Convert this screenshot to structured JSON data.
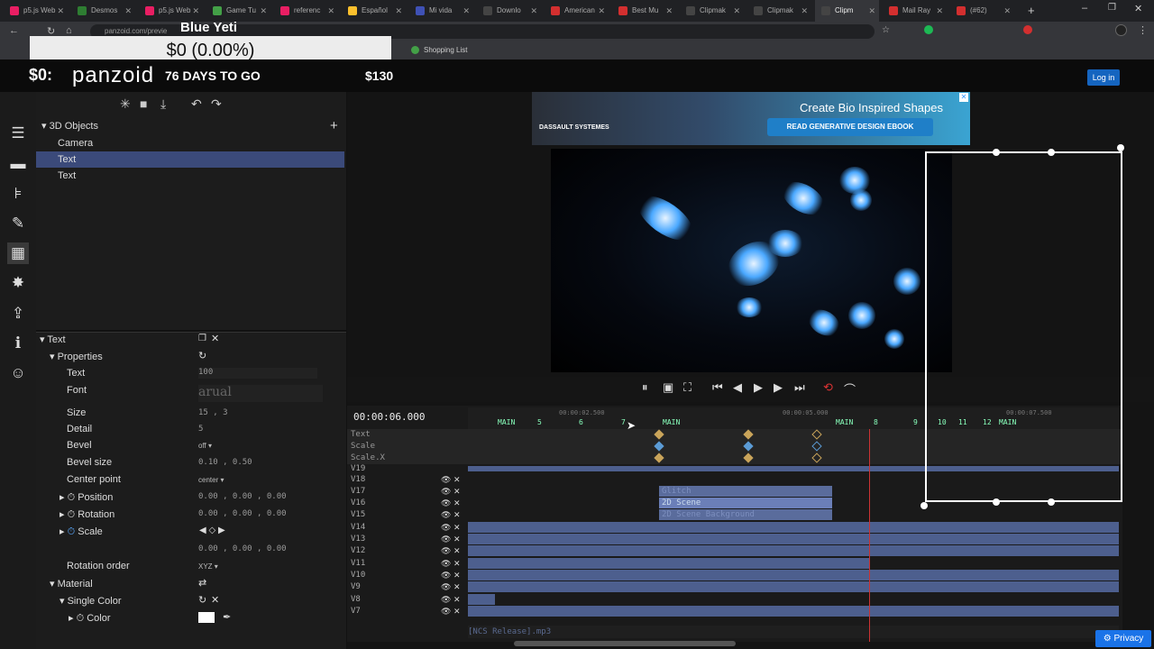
{
  "browser": {
    "tabs": [
      {
        "label": "p5.js Web",
        "color": "#e91e63"
      },
      {
        "label": "Desmos",
        "color": "#2e7d32"
      },
      {
        "label": "p5.js Web",
        "color": "#e91e63"
      },
      {
        "label": "Game Tu",
        "color": "#43a047"
      },
      {
        "label": "referenc",
        "color": "#e91e63"
      },
      {
        "label": "Español",
        "color": "#fbc02d"
      },
      {
        "label": "Mi vida",
        "color": "#3f51b5"
      },
      {
        "label": "Downlo",
        "color": "#444444"
      },
      {
        "label": "American",
        "color": "#d32f2f"
      },
      {
        "label": "Best Mu",
        "color": "#d32f2f"
      },
      {
        "label": "Clipmak",
        "color": "#444444"
      },
      {
        "label": "Clipmak",
        "color": "#444444"
      },
      {
        "label": "Clipm",
        "color": "#444444"
      },
      {
        "label": "Mail Ray",
        "color": "#d32f2f"
      },
      {
        "label": "(#62)",
        "color": "#d32f2f"
      }
    ],
    "url": "panzoid.com/previe",
    "bookmark": "Shopping List"
  },
  "overlay": {
    "name": "Blue Yeti",
    "donation": "$0 (0.00%)",
    "price_prefix": "$0:",
    "countdown": "76 DAYS TO GO",
    "goal": "$130"
  },
  "site": {
    "logo": "panzoid",
    "login": "Log in"
  },
  "ad": {
    "title": "Create Bio Inspired Shapes",
    "button": "READ GENERATIVE DESIGN EBOOK",
    "brand": "DASSAULT SYSTEMES"
  },
  "objects": {
    "section": "3D Objects",
    "items": [
      "Camera",
      "Text",
      "Text"
    ]
  },
  "properties": {
    "header": "Text",
    "group": "Properties",
    "rows": [
      {
        "label": "Text",
        "value": "100"
      },
      {
        "label": "Font",
        "value": "arual"
      },
      {
        "label": "Size",
        "value": "15 , 3"
      },
      {
        "label": "Detail",
        "value": "5"
      },
      {
        "label": "Bevel",
        "value": "off"
      },
      {
        "label": "Bevel size",
        "value": "0.10 , 0.50"
      },
      {
        "label": "Center point",
        "value": "center"
      },
      {
        "label": "Position",
        "value": "0.00 , 0.00 , 0.00"
      },
      {
        "label": "Rotation",
        "value": "0.00 , 0.00 , 0.00"
      },
      {
        "label": "Scale",
        "value": "0.00 , 0.00 , 0.00"
      },
      {
        "label": "Rotation order",
        "value": "XYZ"
      }
    ],
    "material": "Material",
    "single_color": "Single Color",
    "color": "Color"
  },
  "timeline": {
    "timecode": "00:00:06.000",
    "ruler_times": [
      "00:00:02.500",
      "00:00:05.000",
      "00:00:07.500"
    ],
    "markers": [
      "MAIN",
      "5",
      "6",
      "7",
      "MAIN",
      "MAIN",
      "8",
      "9",
      "10",
      "11",
      "12",
      "MAIN"
    ],
    "keyframe_rows": [
      "Text",
      "Scale",
      "Scale.X"
    ],
    "layers": [
      "V19",
      "V18",
      "V17",
      "V16",
      "V15",
      "V14",
      "V13",
      "V12",
      "V11",
      "V10",
      "V9",
      "V8",
      "V7"
    ],
    "clips": [
      "Glitch",
      "2D Scene",
      "2D Scene Background"
    ],
    "audio": "NCS Release].mp3"
  },
  "privacy": "Privacy"
}
